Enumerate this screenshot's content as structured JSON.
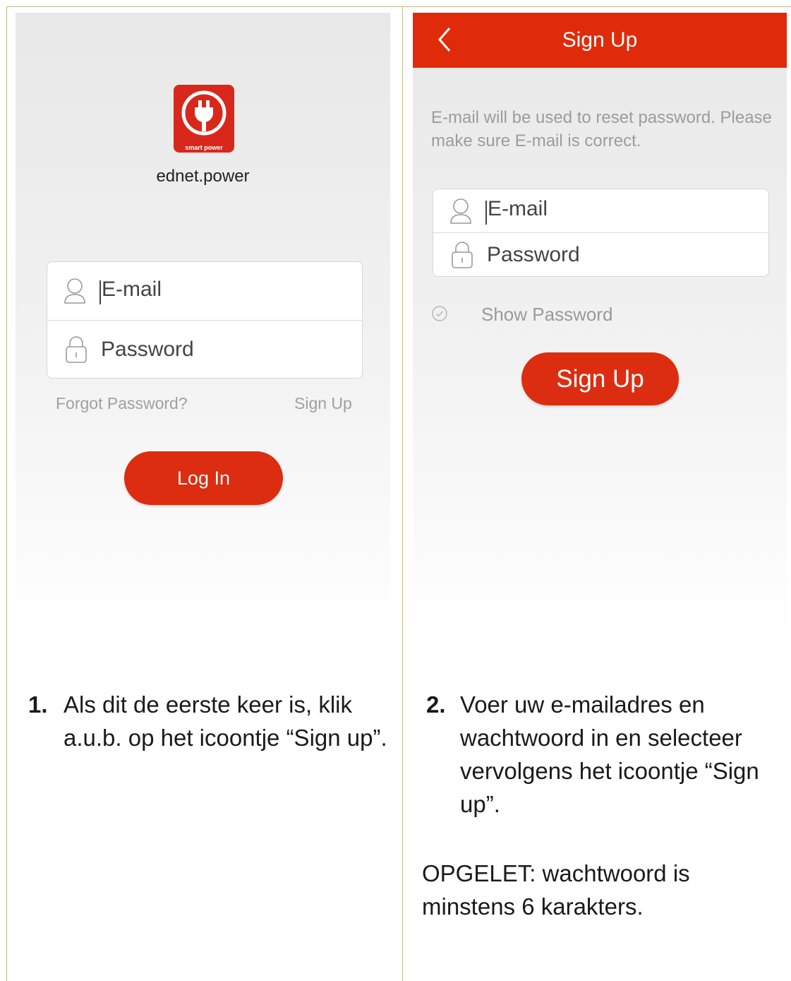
{
  "left_screen": {
    "app_icon_label": "smart power",
    "app_name": "ednet.power",
    "email_placeholder": "E-mail",
    "password_placeholder": "Password",
    "forgot_password": "Forgot Password?",
    "sign_up_link": "Sign Up",
    "login_button": "Log In"
  },
  "right_screen": {
    "title": "Sign Up",
    "note": "E-mail will be used to reset password. Please make sure E-mail is correct.",
    "email_placeholder": "E-mail",
    "password_placeholder": "Password",
    "show_password": "Show Password",
    "signup_button": "Sign Up"
  },
  "captions": {
    "step1_number": "1.",
    "step1_text": "Als dit de eerste keer is, klik a.u.b. op het icoontje “Sign up”.",
    "step2_number": "2.",
    "step2_text": "Voer uw e-mailadres en wachtwoord in en selecteer vervolgens het icoontje “Sign up”.",
    "warning": "OPGELET: wachtwoord is minstens 6 karakters."
  },
  "colors": {
    "accent": "#e02b0a",
    "button": "#dc2d10",
    "border": "#c9b98a"
  },
  "icons": [
    "plug-icon",
    "user-icon",
    "lock-icon",
    "back-icon",
    "check-circle-icon"
  ]
}
